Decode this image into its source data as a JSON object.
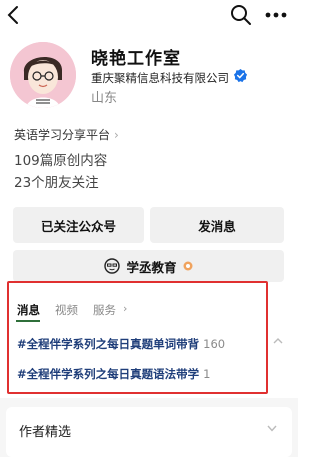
{
  "profile": {
    "account_name": "晓艳工作室",
    "company": "重庆聚精信息科技有限公司",
    "region": "山东",
    "platform_link": "英语学习分享平台",
    "articles": "109篇原创内容",
    "friends": "23个朋友关注"
  },
  "actions": {
    "followed": "已关注公众号",
    "message": "发消息",
    "service": "学丞教育"
  },
  "tabs": [
    "消息",
    "视频",
    "服务"
  ],
  "topics": [
    {
      "title": "#全程伴学系列之每日真题单词带背",
      "count": "160"
    },
    {
      "title": "#全程伴学系列之每日真题语法带学",
      "count": "1"
    }
  ],
  "picks": {
    "title": "作者精选"
  },
  "icons": {
    "back": "back-icon",
    "search": "search-icon",
    "more": "more-icon",
    "verify": "verified-icon",
    "service": "service-logo-icon"
  },
  "colors": {
    "verify": "#1a73e8",
    "highlight": "#e03030",
    "topic_text": "#1f3e7a",
    "tab_underline": "#2f6f3a"
  }
}
